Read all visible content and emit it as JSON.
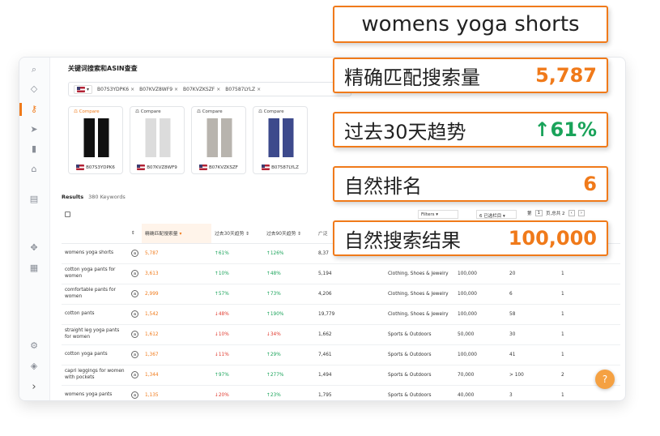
{
  "page": {
    "title": "关键词搜索和ASIN查查"
  },
  "asin_bar": {
    "country": "▾",
    "asins": [
      "B07S3YDPK6",
      "B07KVZ8WF9",
      "B07KVZKSZF",
      "B07587LYLZ"
    ]
  },
  "cards": [
    {
      "compare": "Compare",
      "asin": "B07S3YDPK6"
    },
    {
      "compare": "Compare",
      "asin": "B07KVZ8WF9"
    },
    {
      "compare": "Compare",
      "asin": "B07KVZKSZF"
    },
    {
      "compare": "Compare",
      "asin": "B07587LYLZ"
    }
  ],
  "results": {
    "label": "Results",
    "count": "380 Keywords"
  },
  "toolbar": {
    "filters": "Filters",
    "columns": "6 已选栏目",
    "page_prefix": "第",
    "page": "1",
    "page_suffix": "页,总共 2"
  },
  "table": {
    "headers": [
      "",
      "",
      "精确匹配搜索量",
      "过去30天趋势",
      "过去90天趋势",
      "广泛",
      "",
      "",
      "",
      ""
    ],
    "rows": [
      {
        "keyword": "womens yoga shorts",
        "volume": "5,787",
        "t30": "↑61%",
        "t30c": "green",
        "t90": "↑126%",
        "t90c": "green",
        "broad": "8,37",
        "category": "",
        "results": "",
        "rank": "",
        "sp": ""
      },
      {
        "keyword": "cotton yoga pants for women",
        "volume": "3,613",
        "t30": "↑10%",
        "t30c": "green",
        "t90": "↑48%",
        "t90c": "green",
        "broad": "5,194",
        "category": "Clothing, Shoes & Jewelry",
        "results": "100,000",
        "rank": "20",
        "sp": "1"
      },
      {
        "keyword": "comfortable pants for women",
        "volume": "2,999",
        "t30": "↑57%",
        "t30c": "green",
        "t90": "↑73%",
        "t90c": "green",
        "broad": "4,206",
        "category": "Clothing, Shoes & Jewelry",
        "results": "100,000",
        "rank": "6",
        "sp": "1"
      },
      {
        "keyword": "cotton pants",
        "volume": "1,542",
        "t30": "↓48%",
        "t30c": "red",
        "t90": "↑190%",
        "t90c": "green",
        "broad": "19,779",
        "category": "Clothing, Shoes & Jewelry",
        "results": "100,000",
        "rank": "58",
        "sp": "1"
      },
      {
        "keyword": "straight leg yoga pants for women",
        "volume": "1,612",
        "t30": "↓10%",
        "t30c": "red",
        "t90": "↓34%",
        "t90c": "red",
        "broad": "1,662",
        "category": "Sports & Outdoors",
        "results": "50,000",
        "rank": "30",
        "sp": "1"
      },
      {
        "keyword": "cotton yoga pants",
        "volume": "1,367",
        "t30": "↓11%",
        "t30c": "red",
        "t90": "↑29%",
        "t90c": "green",
        "broad": "7,461",
        "category": "Sports & Outdoors",
        "results": "100,000",
        "rank": "41",
        "sp": "1"
      },
      {
        "keyword": "capri leggings for women with pockets",
        "volume": "1,344",
        "t30": "↑97%",
        "t30c": "green",
        "t90": "↑277%",
        "t90c": "green",
        "broad": "1,494",
        "category": "Sports & Outdoors",
        "results": "70,000",
        "rank": "> 100",
        "sp": "2"
      },
      {
        "keyword": "womens yoga pants",
        "volume": "1,135",
        "t30": "↓20%",
        "t30c": "red",
        "t90": "↑23%",
        "t90c": "green",
        "broad": "1,795",
        "category": "Sports & Outdoors",
        "results": "40,000",
        "rank": "3",
        "sp": "1"
      }
    ]
  },
  "callouts": {
    "keyword": "womens yoga shorts",
    "exact_label": "精确匹配搜索量",
    "exact_value": "5,787",
    "trend_label": "过去30天趋势",
    "trend_value": "↑61%",
    "organic_label": "自然排名",
    "organic_value": "6",
    "results_label": "自然搜索结果",
    "results_value": "100,000"
  },
  "help_icon": "?"
}
